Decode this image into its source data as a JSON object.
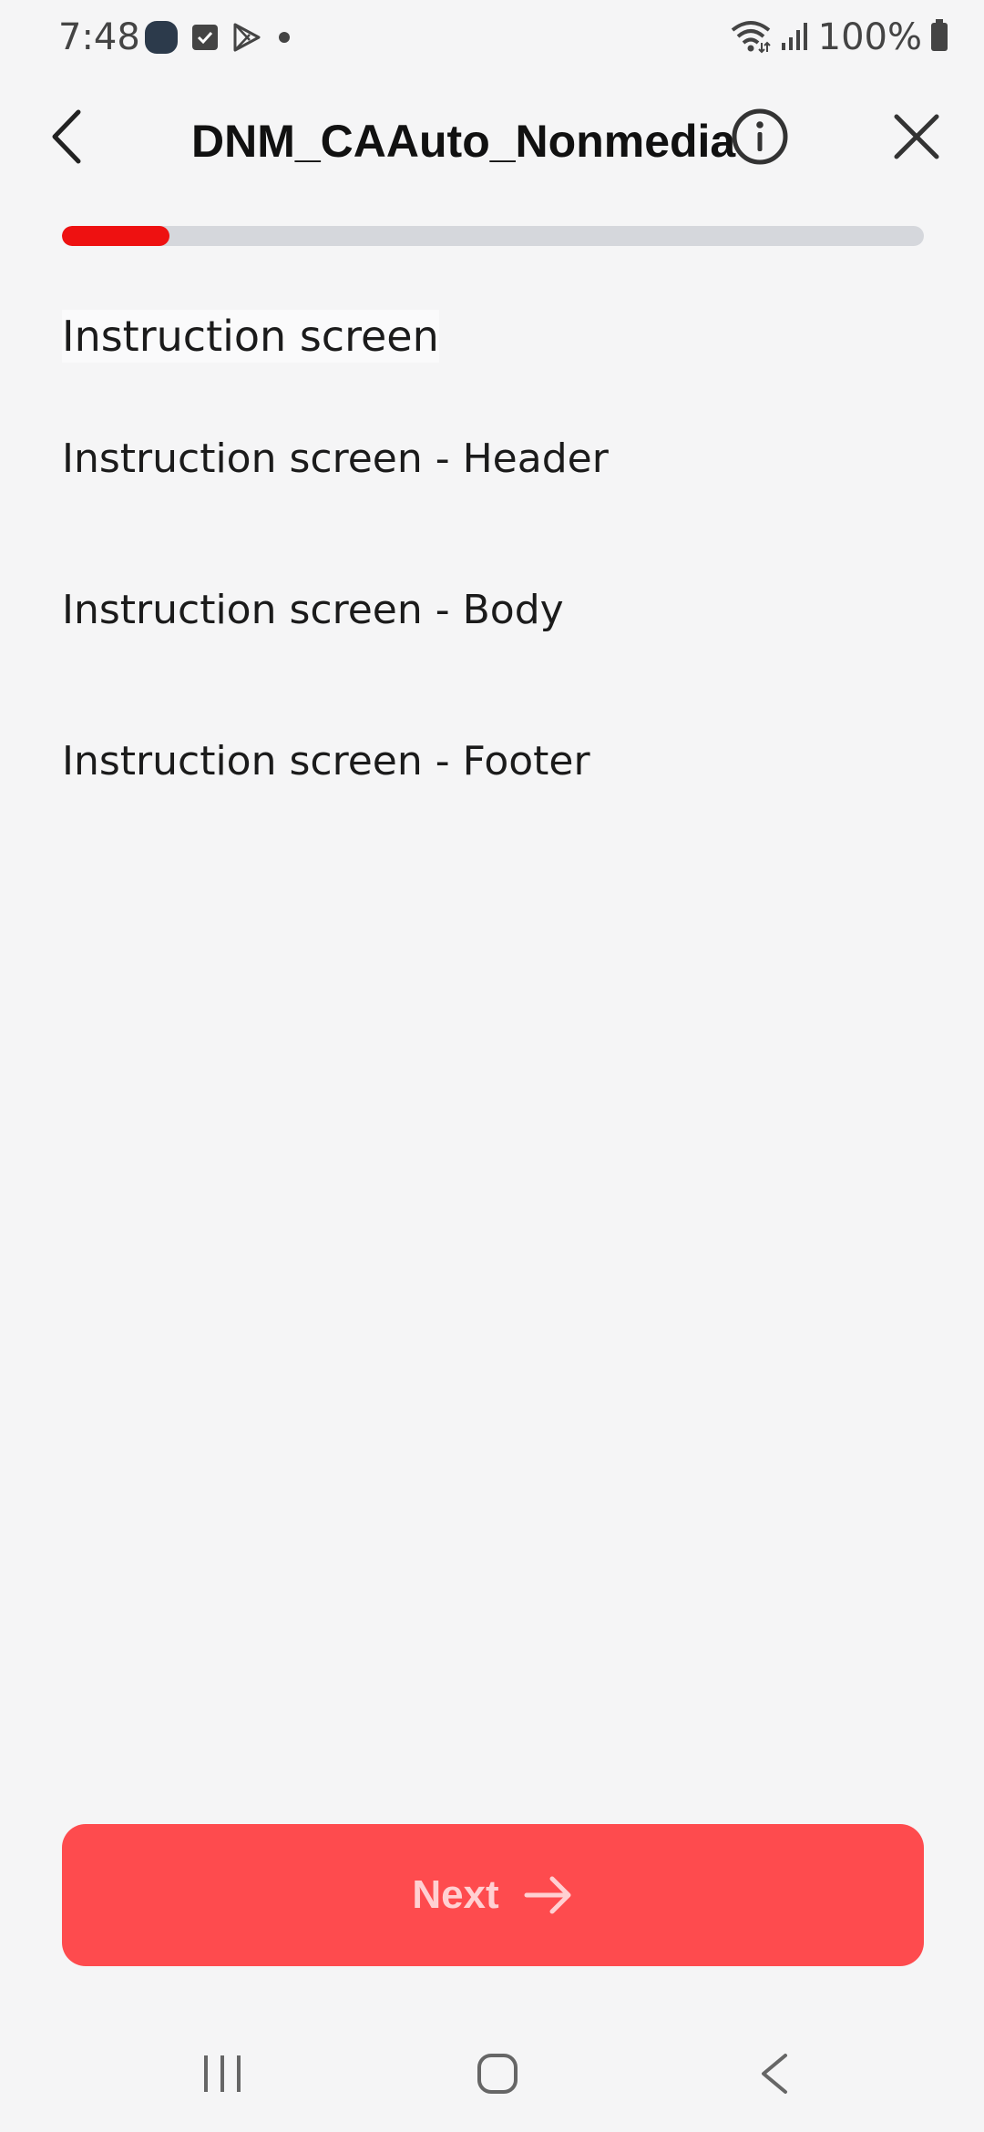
{
  "status_bar": {
    "time": "7:48",
    "battery": "100%",
    "icons_left": [
      "app-icon",
      "checkbox-icon",
      "play-store-icon",
      "dot-icon"
    ],
    "icons_right": [
      "wifi-icon",
      "signal-icon",
      "battery-icon"
    ]
  },
  "header": {
    "title": "DNM_CAAuto_Nonmedia",
    "back_icon": "chevron-left-icon",
    "info_icon": "info-icon",
    "close_icon": "close-icon"
  },
  "progress": {
    "fraction": 0.125,
    "color": "#ee1111",
    "track_color": "#d5d7dc"
  },
  "content": {
    "section_title": "Instruction screen",
    "items": [
      "Instruction screen - Header",
      "Instruction screen - Body",
      "Instruction screen - Footer"
    ]
  },
  "footer": {
    "next_label": "Next",
    "next_icon": "arrow-right-icon",
    "button_color": "#fe4b4e"
  },
  "nav": {
    "icons": [
      "recent-apps-icon",
      "home-icon",
      "back-icon"
    ]
  }
}
